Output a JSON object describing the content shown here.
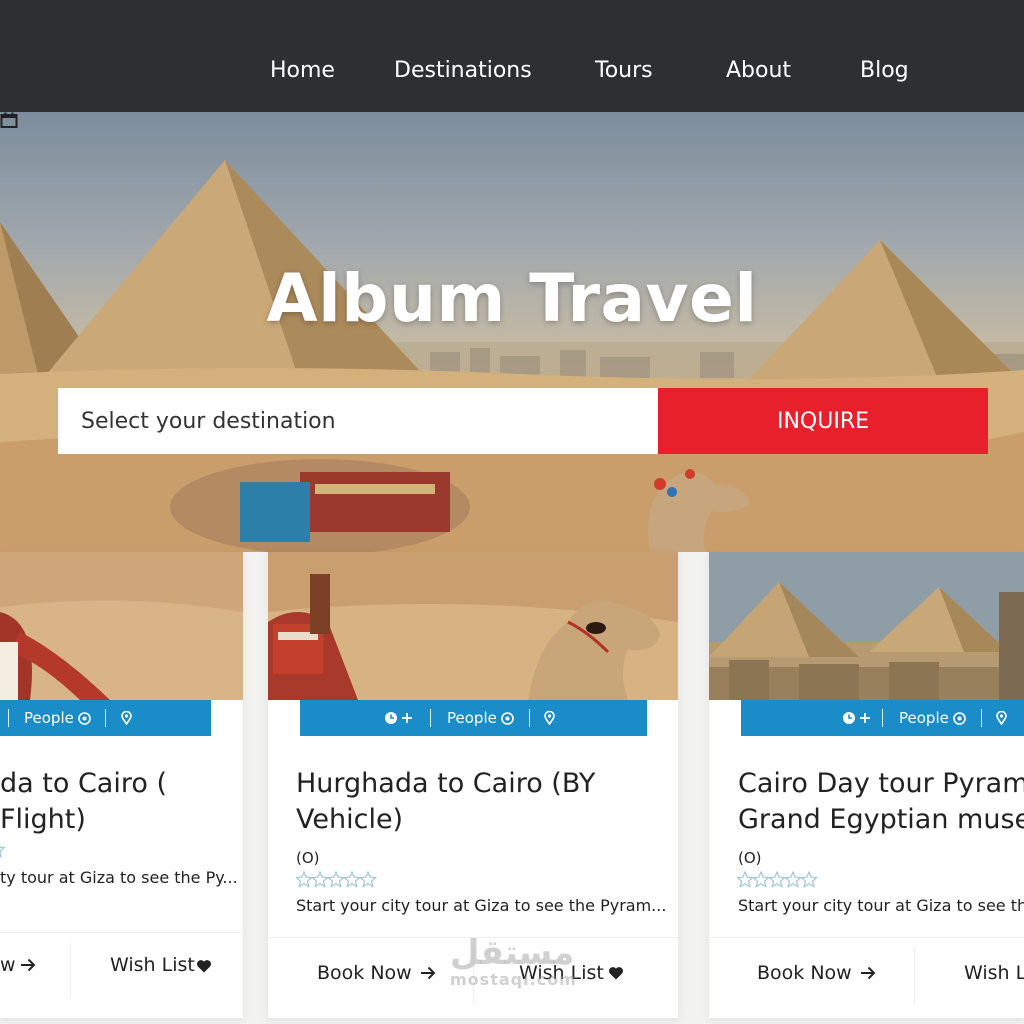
{
  "nav": {
    "items": [
      {
        "label": "Home"
      },
      {
        "label": "Destinations"
      },
      {
        "label": "Tours"
      },
      {
        "label": "About"
      },
      {
        "label": "Blog"
      }
    ]
  },
  "hero": {
    "title": "Album Travel",
    "search_placeholder": "Select your destination",
    "inquire_label": "INQUIRE"
  },
  "cards": [
    {
      "title": "da to Cairo ( Flight)",
      "people_label": "People",
      "rating_count": "",
      "description": "ty tour at Giza to see the Py...",
      "book_label": "w",
      "wish_label": "Wish List"
    },
    {
      "title": "Hurghada to Cairo (BY\nVehicle)",
      "people_label": "People",
      "rating_count": "(O)",
      "description": "Start your city tour at Giza to see the Pyram...",
      "book_label": "Book Now",
      "wish_label": "Wish List"
    },
    {
      "title": "Cairo Day tour Pyramid\nGrand Egyptian museu",
      "people_label": "People",
      "rating_count": "(O)",
      "description": "Start your city tour at Giza to see the",
      "book_label": "Book Now",
      "wish_label": "Wish L"
    }
  ],
  "watermark": {
    "arabic": "مستقل",
    "latin": "mostaqi.com"
  },
  "colors": {
    "header_bg": "#2e2f31",
    "accent_red": "#e8202b",
    "meta_blue": "#1a8cc7"
  },
  "icons": [
    "calendar-icon",
    "clock-plus-icon",
    "people-icon",
    "location-pin-icon",
    "star-icon",
    "arrow-right-icon",
    "heart-icon"
  ]
}
